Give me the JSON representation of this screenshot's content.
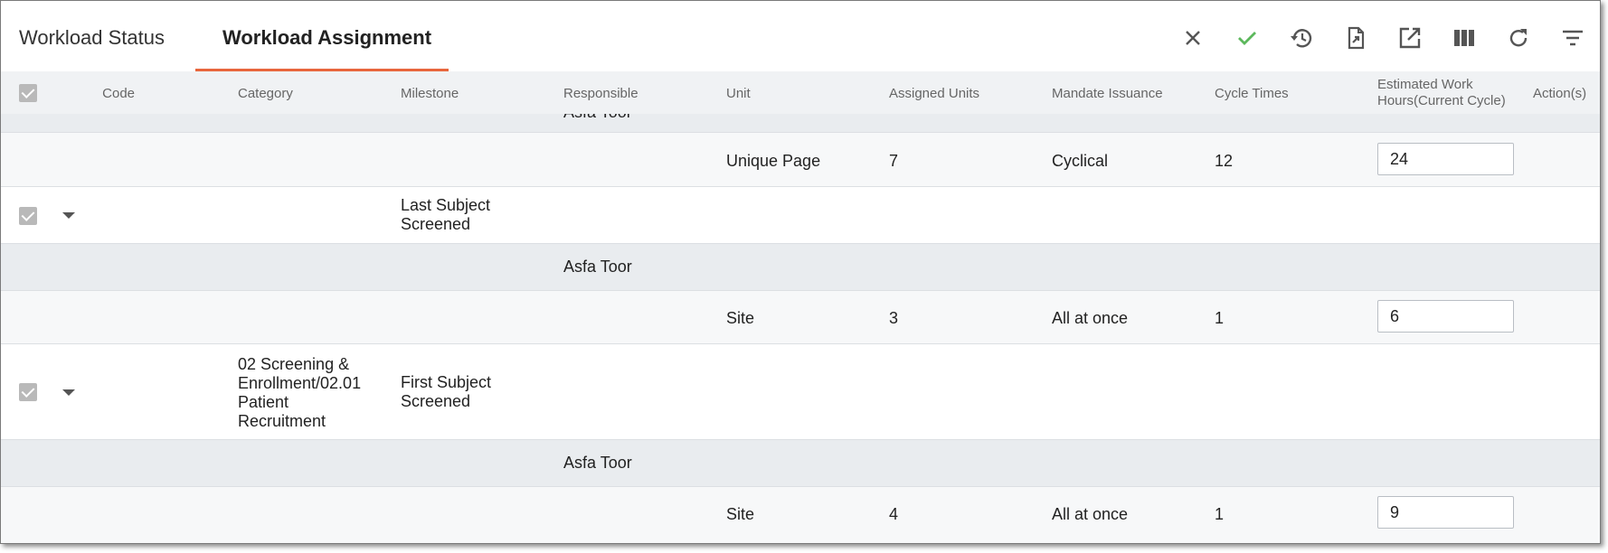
{
  "tabs": {
    "status_label": "Workload Status",
    "assignment_label": "Workload Assignment",
    "active": "Workload Assignment",
    "accent_color": "#e8663d"
  },
  "toolbar": {
    "icons": [
      "close-icon",
      "check-icon",
      "history-icon",
      "export-file-icon",
      "open-external-icon",
      "columns-icon",
      "refresh-icon",
      "filter-icon"
    ],
    "check_color": "#5cb85c"
  },
  "columns": {
    "code": "Code",
    "category": "Category",
    "milestone": "Milestone",
    "responsible": "Responsible",
    "unit": "Unit",
    "assigned_units": "Assigned Units",
    "mandate_issuance": "Mandate Issuance",
    "cycle_times": "Cycle Times",
    "estimated_hours": "Estimated Work Hours(Current Cycle)",
    "actions": "Action(s)"
  },
  "rows": {
    "partial_responsible": "Asfa Toor",
    "r1_unit": {
      "unit": "Unique Page",
      "assigned_units": "7",
      "mandate": "Cyclical",
      "cycles": "12",
      "hours": "24"
    },
    "m1": {
      "milestone": "Last Subject Screened"
    },
    "r1_resp": {
      "responsible": "Asfa Toor"
    },
    "r2_unit": {
      "unit": "Site",
      "assigned_units": "3",
      "mandate": "All at once",
      "cycles": "1",
      "hours": "6"
    },
    "m2": {
      "category": "02 Screening & Enrollment/02.01 Patient Recruitment",
      "milestone": "First Subject Screened"
    },
    "r2_resp": {
      "responsible": "Asfa Toor"
    },
    "r3_unit": {
      "unit": "Site",
      "assigned_units": "4",
      "mandate": "All at once",
      "cycles": "1",
      "hours": "9"
    }
  }
}
